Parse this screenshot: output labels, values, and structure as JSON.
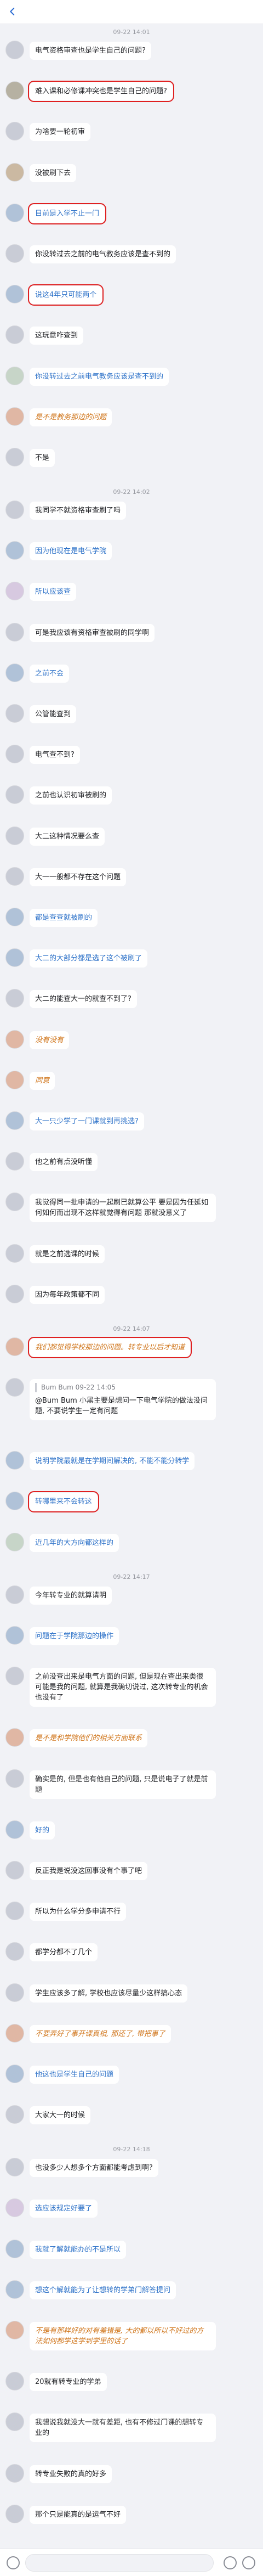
{
  "header": {
    "title": ""
  },
  "colors": {
    "accent": "#e02020",
    "link": "#2a6bd3",
    "bubble": "#ffffff",
    "background": "#f1f2f6"
  },
  "timestamps": [
    "09-22 14:01",
    "09-22 14:02",
    "09-22 14:07",
    "09-22 14:17",
    "09-22 14:18"
  ],
  "messages": [
    {
      "text": "电气资格审查也是学生自己的问题?",
      "avatar_color": "#c9ccd6",
      "style": ""
    },
    {
      "text": "难入课和必修课冲突也是学生自己的问题?",
      "avatar_color": "#b6b1a2",
      "style": "hl"
    },
    {
      "text": "为啥要一轮初审",
      "avatar_color": "#c9ccd6",
      "style": ""
    },
    {
      "text": "没被刷下去",
      "avatar_color": "#cbb9a2",
      "style": ""
    },
    {
      "text": "目前是入学不止一门",
      "avatar_color": "#b0c2d8",
      "style": "hl blue"
    },
    {
      "text": "你没转过去之前的电气教务应该是查不到的",
      "avatar_color": "#c9ccd6",
      "style": ""
    },
    {
      "text": "说这4年只可能两个",
      "avatar_color": "#b0c2d8",
      "style": "hl blue"
    },
    {
      "text": "这玩意咋查到",
      "avatar_color": "#c9ccd6",
      "style": ""
    },
    {
      "text": "你没转过去之前电气教务应该是查不到的",
      "avatar_color": "#c7d5c8",
      "style": "blue"
    },
    {
      "text": "是不是教务那边的问题",
      "avatar_color": "#e0b7a4",
      "style": "cursive"
    },
    {
      "text": "不是",
      "avatar_color": "#c9ccd6",
      "style": ""
    },
    {
      "text": "我同学不就资格审查刷了吗",
      "avatar_color": "#c9ccd6",
      "style": ""
    },
    {
      "text": "因为他现在是电气学院",
      "avatar_color": "#b0c2d8",
      "style": "blue"
    },
    {
      "text": "所以应该查",
      "avatar_color": "#d7c9e0",
      "style": "blue"
    },
    {
      "text": "可是我应该有资格审查被刷的同学啊",
      "avatar_color": "#c9ccd6",
      "style": ""
    },
    {
      "text": "之前不会",
      "avatar_color": "#b0c2d8",
      "style": "blue"
    },
    {
      "text": "公管能查到",
      "avatar_color": "#c9ccd6",
      "style": ""
    },
    {
      "text": "电气查不到?",
      "avatar_color": "#c9ccd6",
      "style": ""
    },
    {
      "text": "之前也认识初审被刷的",
      "avatar_color": "#c9ccd6",
      "style": ""
    },
    {
      "text": "大二这种情况要么查",
      "avatar_color": "#c9ccd6",
      "style": ""
    },
    {
      "text": "大一一般都不存在这个问题",
      "avatar_color": "#c9ccd6",
      "style": ""
    },
    {
      "text": "都是查查就被刷的",
      "avatar_color": "#b0c2d8",
      "style": "blue"
    },
    {
      "text": "大二的大部分都是选了这个被刷了",
      "avatar_color": "#b0c2d8",
      "style": "blue"
    },
    {
      "text": "大二的能查大一的就查不到了?",
      "avatar_color": "#c9ccd6",
      "style": ""
    },
    {
      "text": "没有没有",
      "avatar_color": "#e0b7a4",
      "style": "cursive"
    },
    {
      "text": "同意",
      "avatar_color": "#e0b7a4",
      "style": "cursive"
    },
    {
      "text": "大一只少学了一门课就到再挑选?",
      "avatar_color": "#b0c2d8",
      "style": "blue"
    },
    {
      "text": "他之前有点没听懂",
      "avatar_color": "#c9ccd6",
      "style": ""
    },
    {
      "text": "我觉得同一批申请的一起刷已就算公平 要是因为任延如何如何而出现不这样就觉得有问题 那就没意义了",
      "avatar_color": "#c9ccd6",
      "style": ""
    },
    {
      "text": "就是之前选课的时候",
      "avatar_color": "#c9ccd6",
      "style": ""
    },
    {
      "text": "因为每年政策都不同",
      "avatar_color": "#c9ccd6",
      "style": ""
    },
    {
      "text": "我们都觉得学校那边的问题。转专业以后才知道",
      "avatar_color": "#e0b7a4",
      "style": "hl cursive"
    },
    {
      "quote": "Bum Bum 09-22 14:05",
      "text": "@Bum Bum 小黑主要是想问一下电气学院的做法没问题, 不要说学生一定有问题",
      "avatar_color": "#c9ccd6",
      "style": "quote"
    },
    {
      "text": "说明学院最就是在学期间解决的, 不能不能分转学",
      "avatar_color": "#b0c2d8",
      "style": "blue"
    },
    {
      "text": "转哪里来不会转这",
      "avatar_color": "#b0c2d8",
      "style": "hl blue"
    },
    {
      "text": "近几年的大方向都这样的",
      "avatar_color": "#c7d5c8",
      "style": "blue"
    },
    {
      "text": "今年转专业的就算请明",
      "avatar_color": "#c9ccd6",
      "style": ""
    },
    {
      "text": "问题在于学院那边的操作",
      "avatar_color": "#b0c2d8",
      "style": "blue"
    },
    {
      "text": "之前没查出来是电气方面的问题, 但是现在查出来类很可能是我的问题, 就算是我确切说过, 这次转专业的机会也没有了",
      "avatar_color": "#c9ccd6",
      "style": ""
    },
    {
      "text": "是不是和学院他们的相关方面联系",
      "avatar_color": "#e0b7a4",
      "style": "cursive"
    },
    {
      "text": "确实是的, 但是也有他自己的问题, 只是说电子了就是前题",
      "avatar_color": "#c9ccd6",
      "style": ""
    },
    {
      "text": "好的",
      "avatar_color": "#b0c2d8",
      "style": "blue"
    },
    {
      "text": "反正我是说没这回事没有个事了吧",
      "avatar_color": "#c9ccd6",
      "style": ""
    },
    {
      "text": "所以为什么学分多申请不行",
      "avatar_color": "#c9ccd6",
      "style": ""
    },
    {
      "text": "都学分都不了几个",
      "avatar_color": "#c9ccd6",
      "style": ""
    },
    {
      "text": "学生应该多了解, 学校也应该尽量少这样搞心态",
      "avatar_color": "#c9ccd6",
      "style": ""
    },
    {
      "text": "不要弄好了事开课真相, 那还了, 带把事了",
      "avatar_color": "#e0b7a4",
      "style": "cursive"
    },
    {
      "text": "他这也是学生自己的问题",
      "avatar_color": "#b0c2d8",
      "style": "blue"
    },
    {
      "text": "大家大一的时候",
      "avatar_color": "#c9ccd6",
      "style": ""
    },
    {
      "text": "也没多少人想多个方面都能考虑到啊?",
      "avatar_color": "#c9ccd6",
      "style": ""
    },
    {
      "text": "选应该规定好要了",
      "avatar_color": "#d7c9e0",
      "style": "blue"
    },
    {
      "text": "我就了解就能办的不是所以",
      "avatar_color": "#b0c2d8",
      "style": "blue"
    },
    {
      "text": "想这个解就能为了让想转的学弟门解答提问",
      "avatar_color": "#b0c2d8",
      "style": "blue"
    },
    {
      "text": "不是有那样好的对有差错是, 大的都以所以不好过的方法如何都学这学到学里的话了",
      "avatar_color": "#e0b7a4",
      "style": "cursive"
    },
    {
      "text": "20就有转专业的学弟",
      "avatar_color": "#c9ccd6",
      "style": ""
    },
    {
      "text": "我想说我就没大一就有差距, 也有不修过门课的想转专业的",
      "avatar_color": "#c9ccd6",
      "style": ""
    },
    {
      "text": "转专业失败的真的好多",
      "avatar_color": "#c9ccd6",
      "style": ""
    },
    {
      "text": "那个只是能真的是运气不好",
      "avatar_color": "#c9ccd6",
      "style": ""
    }
  ],
  "input": {
    "placeholder": ""
  }
}
